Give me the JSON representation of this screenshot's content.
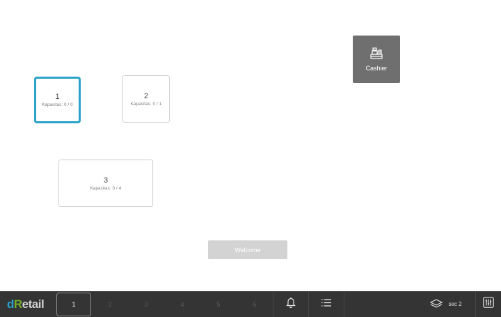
{
  "tables": [
    {
      "number": "1",
      "capacity": "Kapasitas: 0 / 0"
    },
    {
      "number": "2",
      "capacity": "Kapasitas: 0 / 1"
    },
    {
      "number": "3",
      "capacity": "Kapasitas: 0 / 4"
    }
  ],
  "cashier": {
    "label": "Cashier",
    "icon": "cash-register-icon"
  },
  "welcome": {
    "label": "Welcome"
  },
  "bottombar": {
    "logo": {
      "d": "d",
      "r": "R",
      "rest": "etail"
    },
    "pages": [
      "1",
      "2",
      "3",
      "4",
      "5",
      "6"
    ],
    "active_page": "1",
    "section_label": "sec 2"
  },
  "colors": {
    "selected_border": "#2aa3c9",
    "bar_bg": "#343434",
    "cashier_bg": "#6f6f6f",
    "logo_blue": "#2a9fd0",
    "logo_green": "#6fae2a"
  }
}
